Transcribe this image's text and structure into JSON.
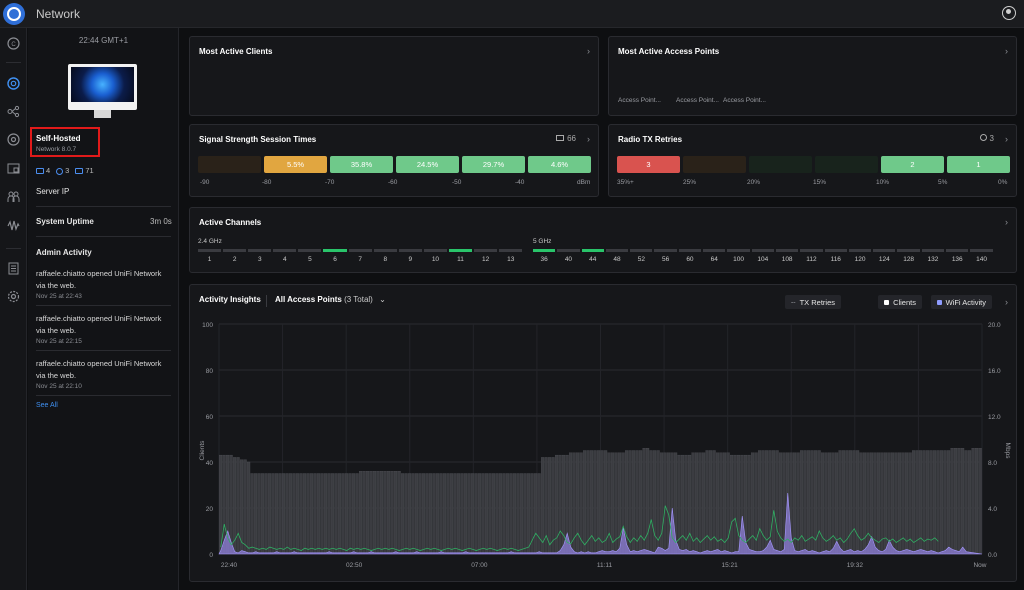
{
  "topbar": {
    "title": "Network"
  },
  "sidebar": {
    "icons": [
      "dashboard-icon",
      "network-globe-icon",
      "topology-icon",
      "target-icon",
      "devices-icon",
      "clients-icon",
      "insights-icon",
      "logs-icon",
      "settings-icon"
    ]
  },
  "left": {
    "time": "22:44 GMT+1",
    "host_title": "Self-Hosted",
    "version": "Network 8.0.7",
    "counts": {
      "gateways": "4",
      "aps": "3",
      "clients": "71"
    },
    "server_ip_label": "Server IP",
    "uptime_label": "System Uptime",
    "uptime_value": "3m 0s",
    "admin_activity_label": "Admin Activity",
    "activities": [
      {
        "text": "raffaele.chiatto opened UniFi Network via the web.",
        "time": "Nov 25 at 22:43"
      },
      {
        "text": "raffaele.chiatto opened UniFi Network via the web.",
        "time": "Nov 25 at 22:15"
      },
      {
        "text": "raffaele.chiatto opened UniFi Network via the web.",
        "time": "Nov 25 at 22:10"
      }
    ],
    "see_all": "See All"
  },
  "cards": {
    "active_clients": {
      "title": "Most Active Clients"
    },
    "active_aps": {
      "title": "Most Active Access Points",
      "labels": [
        "Access Point...",
        "Access Point...",
        "Access Point..."
      ]
    },
    "signal": {
      "title": "Signal Strength Session Times",
      "count": "66",
      "segments": [
        {
          "label": "",
          "color": "#2a2219"
        },
        {
          "label": "5.5%",
          "color": "#e1a640"
        },
        {
          "label": "35.8%",
          "color": "#6fc98a"
        },
        {
          "label": "24.5%",
          "color": "#6fc98a"
        },
        {
          "label": "29.7%",
          "color": "#6fc98a"
        },
        {
          "label": "4.6%",
          "color": "#6fc98a"
        }
      ],
      "ticks": [
        "-90",
        "-80",
        "-70",
        "-60",
        "-50",
        "-40",
        "dBm"
      ]
    },
    "radio_tx": {
      "title": "Radio TX Retries",
      "count": "3",
      "segments": [
        {
          "label": "3",
          "color": "#d9534f"
        },
        {
          "label": "",
          "color": "#2a2219"
        },
        {
          "label": "",
          "color": "#18231c"
        },
        {
          "label": "",
          "color": "#18231c"
        },
        {
          "label": "2",
          "color": "#6fc98a"
        },
        {
          "label": "1",
          "color": "#6fc98a"
        }
      ],
      "ticks": [
        "35%+",
        "25%",
        "20%",
        "15%",
        "10%",
        "5%",
        "0%"
      ]
    },
    "channels": {
      "title": "Active Channels",
      "band24": {
        "label": "2.4 GHz",
        "channels": [
          "1",
          "2",
          "3",
          "4",
          "5",
          "6",
          "7",
          "8",
          "9",
          "10",
          "11",
          "12",
          "13"
        ],
        "active": [
          "6",
          "11"
        ]
      },
      "band5": {
        "label": "5 GHz",
        "channels": [
          "36",
          "40",
          "44",
          "48",
          "52",
          "56",
          "60",
          "64",
          "100",
          "104",
          "108",
          "112",
          "116",
          "120",
          "124",
          "128",
          "132",
          "136",
          "140"
        ],
        "active": [
          "36",
          "44"
        ]
      }
    },
    "insights": {
      "title": "Activity Insights",
      "filter": "All Access Points",
      "filter_sub": "(3 Total)",
      "legend": [
        "TX Retries",
        "Clients",
        "WiFi Activity"
      ],
      "legend_colors": [
        "#8b8d93",
        "#ffffff",
        "#8f9cff"
      ]
    }
  },
  "chart_data": {
    "type": "bar",
    "title": "Activity Insights",
    "ylabel": "Clients",
    "y2label": "Mbps",
    "ylim": [
      0,
      100
    ],
    "y2lim": [
      0,
      20
    ],
    "yticks": [
      "100",
      "80",
      "60",
      "40",
      "20",
      "0"
    ],
    "y2ticks": [
      "20.0",
      "16.0",
      "12.0",
      "8.0",
      "4.0",
      "0.0"
    ],
    "x_ticks": [
      "22:40",
      "02:50",
      "07:00",
      "11:11",
      "15:21",
      "19:32",
      "Now"
    ],
    "series": [
      {
        "name": "Clients",
        "values": [
          43,
          43,
          43,
          43,
          42,
          42,
          41,
          41,
          40,
          35,
          35,
          35,
          35,
          35,
          35,
          35,
          35,
          35,
          35,
          35,
          35,
          35,
          35,
          35,
          35,
          35,
          35,
          35,
          35,
          35,
          35,
          35,
          35,
          35,
          35,
          35,
          35,
          35,
          35,
          35,
          36,
          36,
          36,
          36,
          36,
          36,
          36,
          36,
          36,
          36,
          36,
          36,
          35,
          35,
          35,
          35,
          35,
          35,
          35,
          35,
          35,
          35,
          35,
          35,
          35,
          35,
          35,
          35,
          35,
          35,
          35,
          35,
          35,
          35,
          35,
          35,
          35,
          35,
          35,
          35,
          35,
          35,
          35,
          35,
          35,
          35,
          35,
          35,
          35,
          35,
          35,
          35,
          42,
          42,
          42,
          42,
          43,
          43,
          43,
          43,
          44,
          44,
          44,
          44,
          45,
          45,
          45,
          45,
          45,
          45,
          45,
          44,
          44,
          44,
          44,
          44,
          45,
          45,
          45,
          45,
          45,
          46,
          46,
          45,
          45,
          45,
          44,
          44,
          44,
          44,
          44,
          43,
          43,
          43,
          43,
          44,
          44,
          44,
          44,
          45,
          45,
          45,
          44,
          44,
          44,
          44,
          43,
          43,
          43,
          43,
          43,
          43,
          44,
          44,
          45,
          45,
          45,
          45,
          45,
          45,
          44,
          44,
          44,
          44,
          44,
          44,
          45,
          45,
          45,
          45,
          45,
          45,
          44,
          44,
          44,
          44,
          44,
          45,
          45,
          45,
          45,
          45,
          45,
          44,
          44,
          44,
          44,
          44,
          44,
          44,
          44,
          44,
          44,
          44,
          44,
          44,
          44,
          44,
          45,
          45,
          45,
          45,
          45,
          45,
          45,
          45,
          45,
          45,
          45,
          46,
          46,
          46,
          46,
          45,
          45,
          46,
          46,
          46
        ]
      },
      {
        "name": "WiFi Activity",
        "values": [
          0.3,
          1.2,
          2.0,
          1.0,
          0.2,
          0.1,
          0.3,
          0.2,
          0.1,
          0.1,
          0.2,
          0.1,
          0.1,
          0.1,
          0.1,
          0.1,
          0.2,
          0.1,
          0.1,
          0.1,
          0.1,
          0.2,
          0.1,
          0.1,
          0.1,
          0.1,
          0.1,
          0.1,
          0.1,
          0.1,
          0.1,
          0.2,
          0.1,
          0.1,
          0.1,
          0.1,
          0.1,
          0.1,
          0.2,
          0.1,
          0.1,
          0.1,
          0.1,
          0.2,
          0.1,
          0.1,
          0.1,
          0.1,
          0.1,
          0.1,
          0.2,
          0.1,
          0.1,
          0.1,
          0.1,
          0.1,
          0.2,
          0.1,
          0.1,
          0.1,
          0.1,
          0.1,
          0.1,
          0.2,
          0.1,
          0.1,
          0.1,
          0.1,
          0.1,
          0.1,
          0.2,
          0.1,
          0.1,
          0.1,
          0.1,
          0.1,
          0.1,
          0.1,
          0.1,
          0.1,
          0.1,
          0.1,
          0.1,
          0.2,
          0.1,
          0.1,
          0.1,
          0.1,
          0.1,
          0.1,
          0.1,
          0.2,
          0.1,
          0.1,
          0.1,
          0.1,
          0.1,
          0.3,
          0.8,
          1.8,
          0.6,
          0.2,
          0.1,
          0.2,
          0.1,
          0.2,
          0.1,
          0.1,
          0.2,
          0.3,
          0.2,
          0.2,
          0.3,
          0.2,
          0.5,
          2.3,
          0.8,
          0.2,
          0.3,
          0.2,
          0.3,
          0.4,
          0.3,
          0.2,
          0.1,
          0.6,
          0.5,
          0.3,
          0.5,
          4.0,
          1.2,
          0.4,
          0.3,
          0.4,
          0.2,
          0.3,
          0.2,
          0.1,
          0.2,
          0.3,
          0.2,
          0.3,
          0.4,
          0.2,
          0.3,
          0.2,
          0.1,
          0.2,
          0.2,
          3.3,
          1.0,
          0.4,
          0.3,
          0.2,
          0.2,
          0.3,
          0.6,
          1.2,
          0.4,
          0.3,
          0.2,
          0.4,
          5.3,
          1.4,
          0.3,
          0.2,
          0.3,
          0.4,
          0.2,
          0.3,
          0.2,
          0.1,
          0.2,
          0.3,
          0.2,
          0.5,
          1.1,
          0.5,
          0.2,
          0.3,
          0.4,
          0.2,
          0.3,
          0.2,
          0.4,
          0.8,
          1.5,
          0.6,
          0.3,
          0.2,
          0.4,
          1.2,
          0.6,
          0.3,
          0.2,
          0.3,
          0.4,
          0.3,
          0.2,
          0.3,
          0.4,
          0.3,
          0.2,
          0.3,
          0.2,
          0.1,
          0.2,
          0.3,
          0.6,
          0.4,
          0.3,
          0.2,
          0.6,
          0.2
        ]
      },
      {
        "name": "TX Retries",
        "values": [
          0.6,
          2.6,
          1.4,
          0.8,
          1.2,
          1.8,
          1.0,
          0.8,
          0.5,
          0.6,
          0.5,
          0.4,
          0.5,
          0.4,
          0.6,
          0.5,
          0.4,
          0.5,
          0.4,
          0.6,
          0.4,
          0.5,
          0.4,
          0.3,
          0.5,
          0.4,
          0.5,
          0.4,
          0.5,
          0.4,
          0.5,
          0.4,
          0.5,
          0.4,
          0.5,
          0.4,
          0.3,
          0.5,
          0.4,
          0.5,
          0.4,
          0.5,
          0.4,
          0.3,
          0.4,
          0.5,
          0.4,
          0.5,
          0.4,
          0.5,
          0.4,
          0.3,
          0.4,
          0.5,
          0.4,
          0.5,
          0.4,
          0.3,
          0.4,
          0.5,
          0.4,
          0.5,
          0.4,
          0.3,
          0.4,
          0.5,
          0.4,
          0.5,
          0.4,
          0.3,
          0.4,
          0.5,
          0.4,
          0.3,
          0.4,
          0.5,
          0.4,
          0.5,
          0.4,
          0.3,
          0.4,
          0.5,
          0.4,
          0.5,
          0.4,
          0.3,
          0.4,
          0.5,
          0.6,
          1.2,
          1.8,
          1.4,
          1.0,
          1.6,
          0.8,
          1.2,
          1.4,
          2.0,
          1.6,
          1.0,
          0.9,
          1.4,
          1.8,
          1.2,
          0.8,
          1.2,
          1.6,
          1.1,
          1.4,
          1.0,
          1.2,
          1.8,
          1.0,
          1.3,
          1.5,
          2.4,
          1.5,
          1.0,
          1.4,
          1.1,
          1.6,
          1.2,
          1.8,
          3.0,
          1.6,
          1.2,
          1.8,
          4.2,
          3.4,
          1.4,
          1.0,
          1.3,
          1.6,
          1.2,
          1.8,
          1.1,
          1.4,
          1.0,
          1.3,
          1.6,
          1.2,
          1.5,
          1.1,
          1.3,
          1.0,
          1.4,
          2.8,
          3.1,
          1.6,
          1.2,
          1.0,
          1.3,
          1.6,
          1.2,
          2.2,
          1.6,
          1.2,
          1.5,
          3.8,
          2.0,
          1.4,
          1.1,
          1.3,
          1.0,
          1.4,
          1.2,
          1.6,
          1.1,
          1.3,
          1.5,
          1.2,
          2.0,
          1.4,
          1.1,
          1.3,
          1.6,
          1.2,
          1.4,
          1.0,
          1.3,
          1.8,
          2.2,
          1.6,
          1.2,
          1.4,
          1.8,
          1.4,
          1.2,
          1.0,
          1.3,
          1.4,
          1.1,
          1.3,
          1.0,
          1.2,
          1.4,
          1.1,
          1.3,
          1.0,
          1.2,
          1.4,
          1.1,
          1.3,
          1.2,
          1.4,
          1.1
        ]
      }
    ]
  }
}
